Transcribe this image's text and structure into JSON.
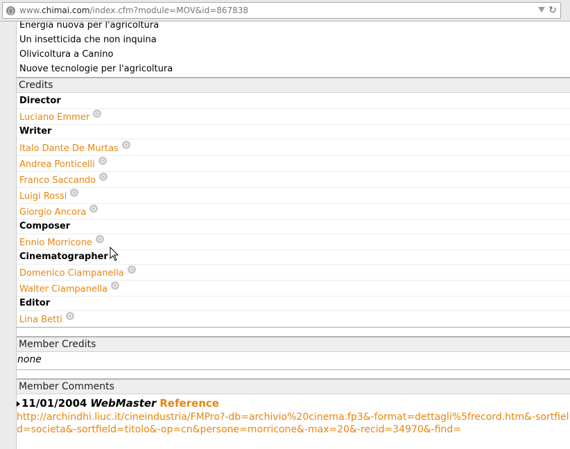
{
  "browser": {
    "url_prefix": "www.",
    "url_host": "chimai.com",
    "url_path": "/index.cfm?module=MOV&id=867838"
  },
  "topics": [
    "Energia nuova per l'agricoltura",
    "Un insetticida che non inquina",
    "Olivicoltura a Canino",
    "Nuove tecnologie per l'agricoltura"
  ],
  "credits": {
    "heading": "Credits",
    "groups": [
      {
        "role": "Director",
        "people": [
          "Luciano Emmer"
        ]
      },
      {
        "role": "Writer",
        "people": [
          "Italo Dante De Murtas",
          "Andrea Ponticelli",
          "Franco Saccando",
          "Luigi Rossi",
          "Giorgio Ancora"
        ]
      },
      {
        "role": "Composer",
        "people": [
          "Ennio Morricone"
        ]
      },
      {
        "role": "Cinematographer",
        "people": [
          "Domenico Ciampanella",
          "Walter Ciampanella"
        ]
      },
      {
        "role": "Editor",
        "people": [
          "Lina Betti"
        ]
      }
    ]
  },
  "member_credits": {
    "heading": "Member Credits",
    "value": "none"
  },
  "member_comments": {
    "heading": "Member Comments",
    "date": "11/01/2004",
    "author": "WebMaster",
    "ref_label": "Reference",
    "link": "http://archindhi.liuc.it/cineindustria/FMPro?-db=archivio%20cinema.fp3&-format=dettagli%5frecord.htm&-sortfield=societa&-sortfield=titolo&-op=cn&persone=morricone&-max=20&-recid=34970&-find="
  },
  "icons": {
    "site": "globe-icon",
    "search": "magnifier-icon",
    "reload": "reload-icon",
    "dropdown": "chevron-down-icon"
  },
  "colors": {
    "link": "#e8850c",
    "header_bg": "#eeeeee"
  }
}
